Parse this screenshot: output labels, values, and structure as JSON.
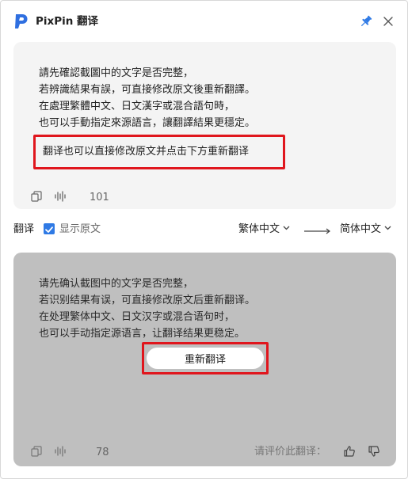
{
  "app": {
    "title": "PixPin 翻译"
  },
  "source": {
    "lines": [
      "請先確認截圖中的文字是否完整，",
      "若辨識結果有誤，可直接修改原文後重新翻譯。",
      "在處理繁體中文、日文漢字或混合語句時，",
      "也可以手動指定來源語言，讓翻譯結果更穩定。"
    ],
    "edit_tip": "翻译也可以直接修改原文并点击下方重新翻译",
    "count": "101"
  },
  "toolbar": {
    "translate_label": "翻译",
    "show_original_label": "显示原文",
    "show_original_checked": true,
    "source_lang": "繁体中文",
    "target_lang": "简体中文"
  },
  "result": {
    "lines": [
      "请先确认截图中的文字是否完整，",
      "若识别结果有误，可直接修改原文后重新翻译。",
      "在处理繁体中文、日文汉字或混合语句时，",
      "也可以手动指定源语言，让翻译结果更稳定。"
    ],
    "retry_label": "重新翻译",
    "count": "78",
    "rate_label": "请评价此翻译："
  },
  "colors": {
    "accent": "#2f7ae5",
    "highlight": "#e0161d",
    "source_bg": "#f4f4f4",
    "result_bg": "#bfbfbf"
  },
  "icons": {
    "logo": "pixpin-logo-icon",
    "pin": "pin-icon",
    "close": "close-icon",
    "copy": "copy-icon",
    "speak": "audio-wave-icon",
    "chevron": "chevron-down-icon",
    "arrow": "arrow-right-icon",
    "thumbs_up": "thumbs-up-icon",
    "thumbs_down": "thumbs-down-icon"
  }
}
